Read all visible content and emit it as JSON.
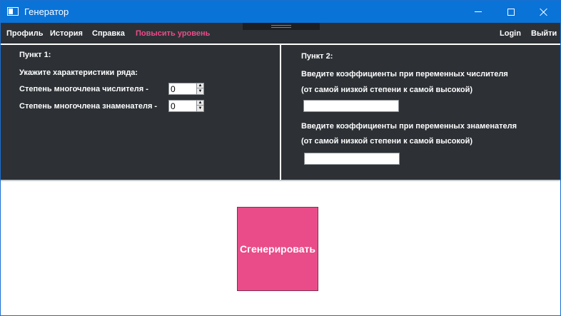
{
  "window": {
    "title": "Генератор",
    "icon": "app-window-icon",
    "controls": [
      "minimize-icon",
      "maximize-icon",
      "close-icon"
    ]
  },
  "menu": {
    "profile": "Профиль",
    "history": "История",
    "help": "Справка",
    "upgrade": "Повысить уровень",
    "login": "Login",
    "logout": "Выйти"
  },
  "left_panel": {
    "heading": "Пункт 1:",
    "subheading": "Укажите характеристики ряда:",
    "numerator_label": "Степень многочлена числителя -",
    "numerator_value": "0",
    "denominator_label": "Степень многочлена знаменателя -",
    "denominator_value": "0"
  },
  "right_panel": {
    "heading": "Пункт 2:",
    "numerator_prompt": "Введите коэффициенты при переменных числителя",
    "numerator_hint": "(от самой низкой степени к самой высокой)",
    "numerator_coeffs": "",
    "denominator_prompt": "Введите коэффициенты при переменных знаменателя",
    "denominator_hint": "(от самой низкой степени к самой высокой)",
    "denominator_coeffs": ""
  },
  "actions": {
    "generate": "Сгенерировать"
  },
  "colors": {
    "titlebar": "#0a73d8",
    "panel_bg": "#2d3136",
    "accent": "#e94c89"
  }
}
